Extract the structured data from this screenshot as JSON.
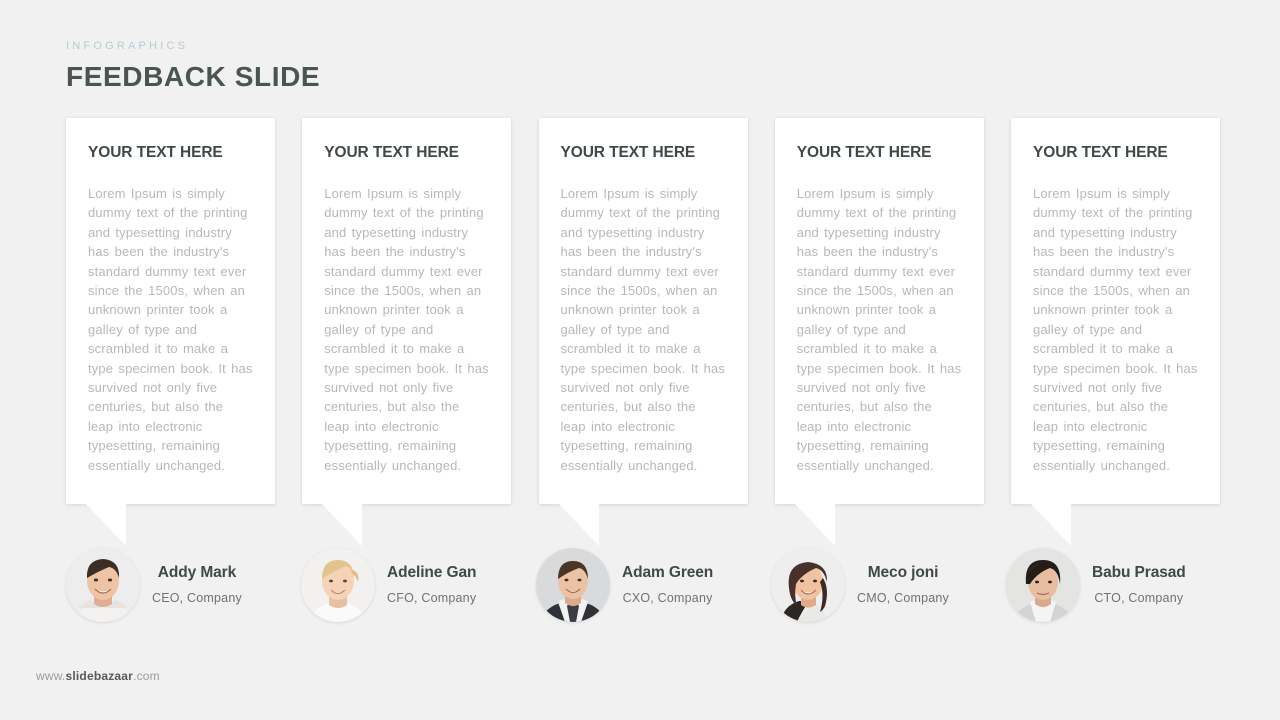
{
  "header": {
    "eyebrow": "INFOGRAPHICS",
    "title": "FEEDBACK SLIDE"
  },
  "colors": {
    "background": "#f1f1f1",
    "card_background": "#ffffff",
    "eyebrow": "#b9ccd4",
    "title": "#4a5553",
    "body_text": "#b5b8ba",
    "role_text": "#6e7371",
    "footer_text": "#9b9b9b"
  },
  "cards": [
    {
      "title": "YOUR TEXT HERE",
      "body": "Lorem Ipsum is simply dummy text of the printing and typesetting industry has been the industry's standard dummy text ever since the 1500s, when an unknown printer took a galley of type and scrambled it to make a type specimen book. It has survived not only five centuries, but also the leap into electronic typesetting, remaining essentially unchanged."
    },
    {
      "title": "YOUR TEXT HERE",
      "body": "Lorem Ipsum is simply dummy text of the printing and typesetting industry has been the industry's standard dummy text ever since the 1500s, when an unknown printer took a galley of type and scrambled it to make a type specimen book. It has survived not only five centuries, but also the leap into electronic typesetting, remaining essentially unchanged."
    },
    {
      "title": "YOUR TEXT HERE",
      "body": "Lorem Ipsum is simply dummy text of the printing and typesetting industry has been the industry's standard dummy text ever since the 1500s, when an unknown printer took a galley of type and scrambled it to make a type specimen book. It has survived not only five centuries, but also the leap into electronic typesetting, remaining essentially unchanged."
    },
    {
      "title": "YOUR TEXT HERE",
      "body": "Lorem Ipsum is simply dummy text of the printing and typesetting industry has been the industry's standard dummy text ever since the 1500s, when an unknown printer took a galley of type and scrambled it to make a type specimen book. It has survived not only five centuries, but also the leap into electronic typesetting, remaining essentially unchanged."
    },
    {
      "title": "YOUR TEXT HERE",
      "body": "Lorem Ipsum is simply dummy text of the printing and typesetting industry has been the industry's standard dummy text ever since the 1500s, when an unknown printer took a galley of type and scrambled it to make a type specimen book. It has survived not only five centuries, but also the leap into electronic typesetting, remaining essentially unchanged."
    }
  ],
  "people": [
    {
      "name": "Addy Mark",
      "role": "CEO, Company",
      "avatar": "photo-man-smiling-white-shirt"
    },
    {
      "name": "Adeline Gan",
      "role": "CFO, Company",
      "avatar": "photo-woman-blonde-smiling"
    },
    {
      "name": "Adam Green",
      "role": "CXO, Company",
      "avatar": "photo-man-dark-suit-tie"
    },
    {
      "name": "Meco joni",
      "role": "CMO, Company",
      "avatar": "photo-woman-curly-brown-hair"
    },
    {
      "name": "Babu Prasad",
      "role": "CTO, Company",
      "avatar": "photo-man-dark-hair-casual-shirt"
    }
  ],
  "footer": {
    "prefix": "www.",
    "brand": "slidebazaar",
    "suffix": ".com"
  }
}
